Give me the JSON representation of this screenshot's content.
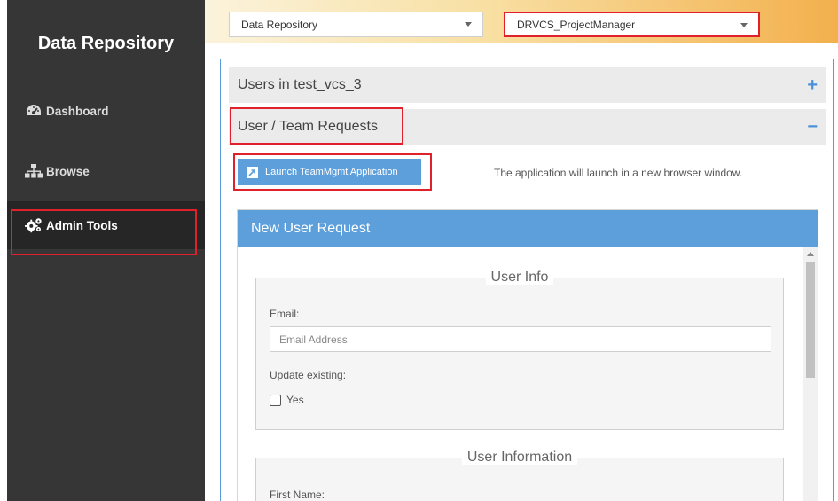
{
  "sidebar": {
    "title": "Data Repository",
    "items": [
      {
        "label": "Dashboard",
        "icon": "dashboard-icon"
      },
      {
        "label": "Browse",
        "icon": "sitemap-icon"
      },
      {
        "label": "Admin Tools",
        "icon": "gears-icon",
        "active": true
      }
    ]
  },
  "topbar": {
    "repository_select": "Data Repository",
    "role_select": "DRVCS_ProjectManager"
  },
  "accordion": {
    "users_title": "Users in test_vcs_3",
    "users_toggle": "+",
    "requests_title": "User / Team Requests",
    "requests_toggle": "−"
  },
  "launch": {
    "button_label": "Launch TeamMgmt Application",
    "note": "The application will launch in a new browser window."
  },
  "panel": {
    "title": "New User Request",
    "user_info_legend": "User Info",
    "email_label": "Email:",
    "email_placeholder": "Email Address",
    "update_label": "Update existing:",
    "yes_label": "Yes",
    "user_information_legend": "User Information",
    "first_name_label": "First Name:"
  },
  "colors": {
    "sidebar_bg": "#363636",
    "accent_blue": "#5d9fdb",
    "highlight_red": "#e0202a"
  }
}
